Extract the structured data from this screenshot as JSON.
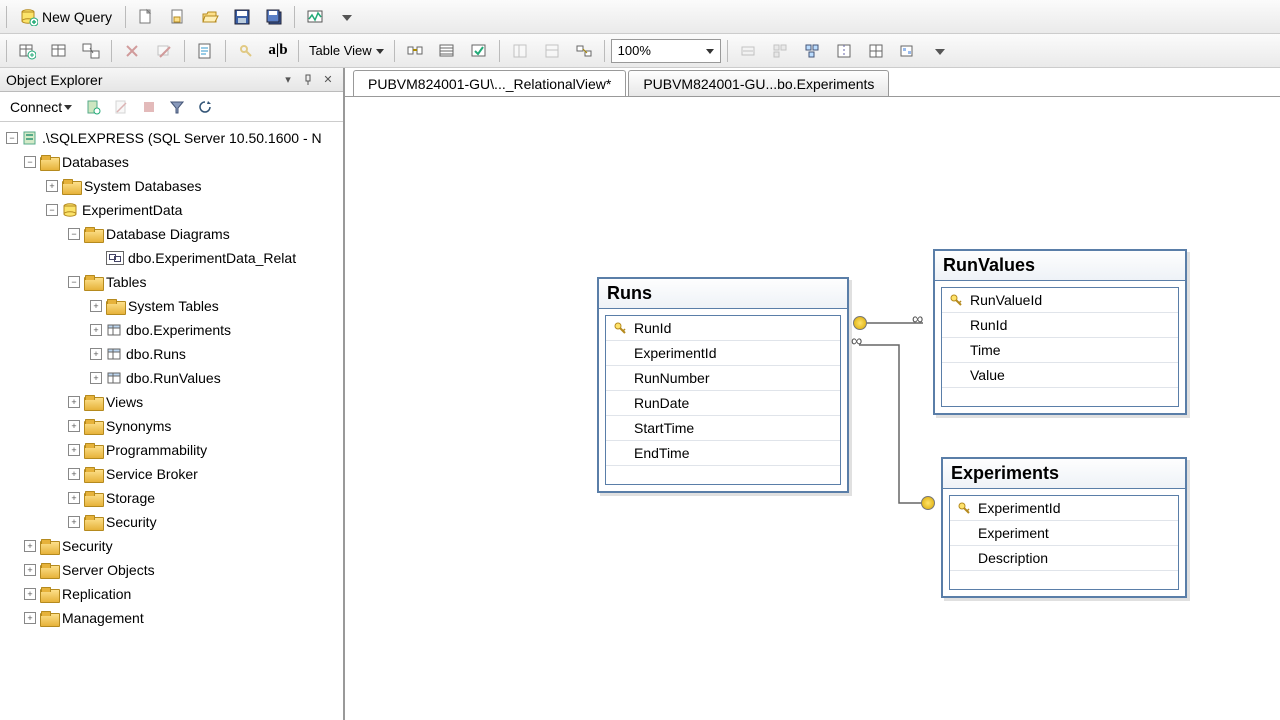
{
  "toolbar": {
    "new_query": "New Query",
    "table_view": "Table View",
    "zoom": "100%"
  },
  "explorer": {
    "title": "Object Explorer",
    "connect": "Connect",
    "server": ".\\SQLEXPRESS (SQL Server 10.50.1600 - N",
    "databases": "Databases",
    "system_databases": "System Databases",
    "experiment_db": "ExperimentData",
    "diagrams": "Database Diagrams",
    "diagram_item": "dbo.ExperimentData_Relat",
    "tables": "Tables",
    "system_tables": "System Tables",
    "tbl_experiments": "dbo.Experiments",
    "tbl_runs": "dbo.Runs",
    "tbl_runvalues": "dbo.RunValues",
    "views": "Views",
    "synonyms": "Synonyms",
    "programmability": "Programmability",
    "service_broker": "Service Broker",
    "storage": "Storage",
    "security": "Security",
    "top_security": "Security",
    "server_objects": "Server Objects",
    "replication": "Replication",
    "management": "Management"
  },
  "tabs": {
    "active": "PUBVM824001-GU\\..._RelationalView*",
    "inactive": "PUBVM824001-GU...bo.Experiments"
  },
  "diagram": {
    "runs": {
      "title": "Runs",
      "cols": [
        "RunId",
        "ExperimentId",
        "RunNumber",
        "RunDate",
        "StartTime",
        "EndTime"
      ],
      "pk": [
        true,
        false,
        false,
        false,
        false,
        false
      ]
    },
    "runvalues": {
      "title": "RunValues",
      "cols": [
        "RunValueId",
        "RunId",
        "Time",
        "Value"
      ],
      "pk": [
        true,
        false,
        false,
        false
      ]
    },
    "experiments": {
      "title": "Experiments",
      "cols": [
        "ExperimentId",
        "Experiment",
        "Description"
      ],
      "pk": [
        true,
        false,
        false
      ]
    }
  }
}
